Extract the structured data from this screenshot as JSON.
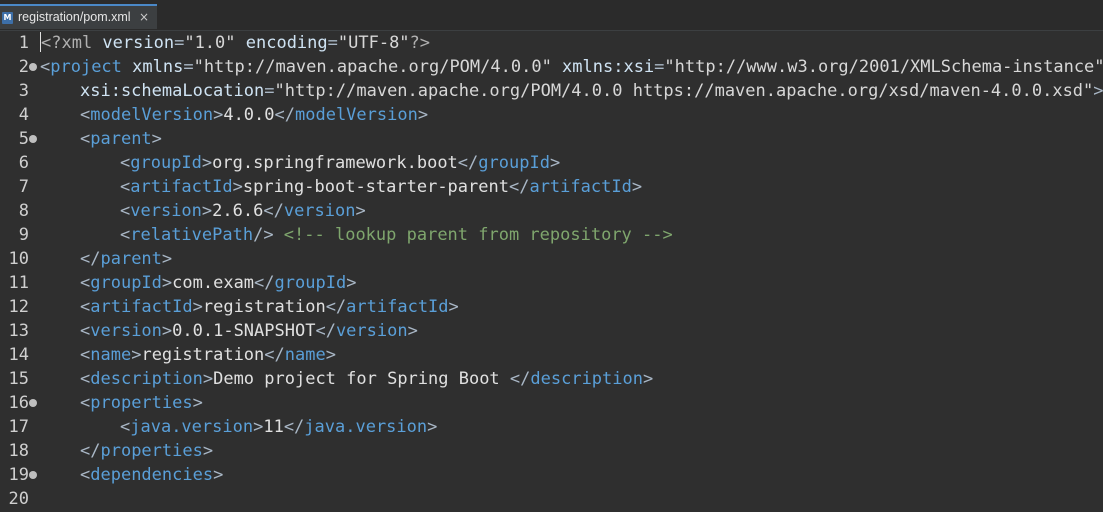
{
  "tab": {
    "title": "registration/pom.xml",
    "icon": "maven-file-icon",
    "close": "×"
  },
  "editor": {
    "line_numbers": [
      "1",
      "2",
      "3",
      "4",
      "5",
      "6",
      "7",
      "8",
      "9",
      "10",
      "11",
      "12",
      "13",
      "14",
      "15",
      "16",
      "17",
      "18",
      "19",
      "20"
    ],
    "fold_markers_on_lines": [
      2,
      5,
      16,
      19
    ],
    "lines": {
      "l1": {
        "open": "<?xml ",
        "a1": "version",
        "eq1": "=",
        "v1": "\"1.0\"",
        "a2": " encoding",
        "eq2": "=",
        "v2": "\"UTF-8\"",
        "close": "?>"
      },
      "l2": {
        "open": "<",
        "tag": "project",
        "a1": " xmlns",
        "eq1": "=",
        "v1": "\"http://maven.apache.org/POM/4.0.0\"",
        "a2": " xmlns:xsi",
        "eq2": "=",
        "v2": "\"http://www.w3.org/2001/XMLSchema-instance\""
      },
      "l3": {
        "a1": "xsi:schemaLocation",
        "eq1": "=",
        "v1": "\"http://maven.apache.org/POM/4.0.0 https://maven.apache.org/xsd/maven-4.0.0.xsd\"",
        "close": ">"
      },
      "l4": {
        "tag": "modelVersion",
        "text": "4.0.0"
      },
      "l5": {
        "tag": "parent"
      },
      "l6": {
        "tag": "groupId",
        "text": "org.springframework.boot"
      },
      "l7": {
        "tag": "artifactId",
        "text": "spring-boot-starter-parent"
      },
      "l8": {
        "tag": "version",
        "text": "2.6.6"
      },
      "l9": {
        "tag": "relativePath",
        "selfclose": "/>",
        "comment": " <!-- lookup parent from repository -->"
      },
      "l10": {
        "tag": "parent"
      },
      "l11": {
        "tag": "groupId",
        "text": "com.exam"
      },
      "l12": {
        "tag": "artifactId",
        "text": "registration"
      },
      "l13": {
        "tag": "version",
        "text": "0.0.1-SNAPSHOT"
      },
      "l14": {
        "tag": "name",
        "text": "registration"
      },
      "l15": {
        "tag": "description",
        "text": "Demo project for Spring Boot "
      },
      "l16": {
        "tag": "properties"
      },
      "l17": {
        "tag": "java.version",
        "text": "11"
      },
      "l18": {
        "tag": "properties"
      },
      "l19": {
        "tag": "dependencies"
      },
      "l20": {}
    }
  },
  "colors": {
    "background": "#2f2f2f",
    "tag_name": "#5a9fd8",
    "bracket": "#a9b7c6",
    "attribute_value": "#b5cea8",
    "comment": "#7fa66d",
    "text": "#e0e0e0",
    "tab_accent": "#4a88c7"
  }
}
